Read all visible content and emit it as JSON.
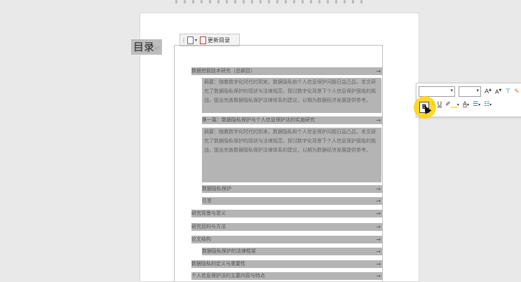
{
  "toc_bar": {
    "update_label": "更新目录"
  },
  "document": {
    "title": "目录",
    "lines": [
      "数据挖掘技术研究（总纲目）",
      "第一篇：数据隐私保护与个人信息保护法的实施研究",
      "摘要：随着数字化时代的到来，数据隐私和个人信息保护问题日益凸显。本文研究了数据隐私保护的现状与法律规范，探讨数字化背景下个人信息保护面临的挑战，提出完善数据隐私保护法律体系的建议，以期为数据经济发展提供参考。",
      "数据隐私保护",
      "引言",
      "研究背景与意义",
      "研究目的与方法",
      "论文结构",
      "数据隐私保护的法律框架",
      "数据隐私的定义与重要性",
      "个人信息保护法的主要内容与特点"
    ]
  },
  "mini_toolbar": {
    "font_name": "",
    "font_size": "",
    "grow_font": "A",
    "shrink_font": "A",
    "bold": "B",
    "italic": "I",
    "underline": "U",
    "font_color": "A"
  }
}
